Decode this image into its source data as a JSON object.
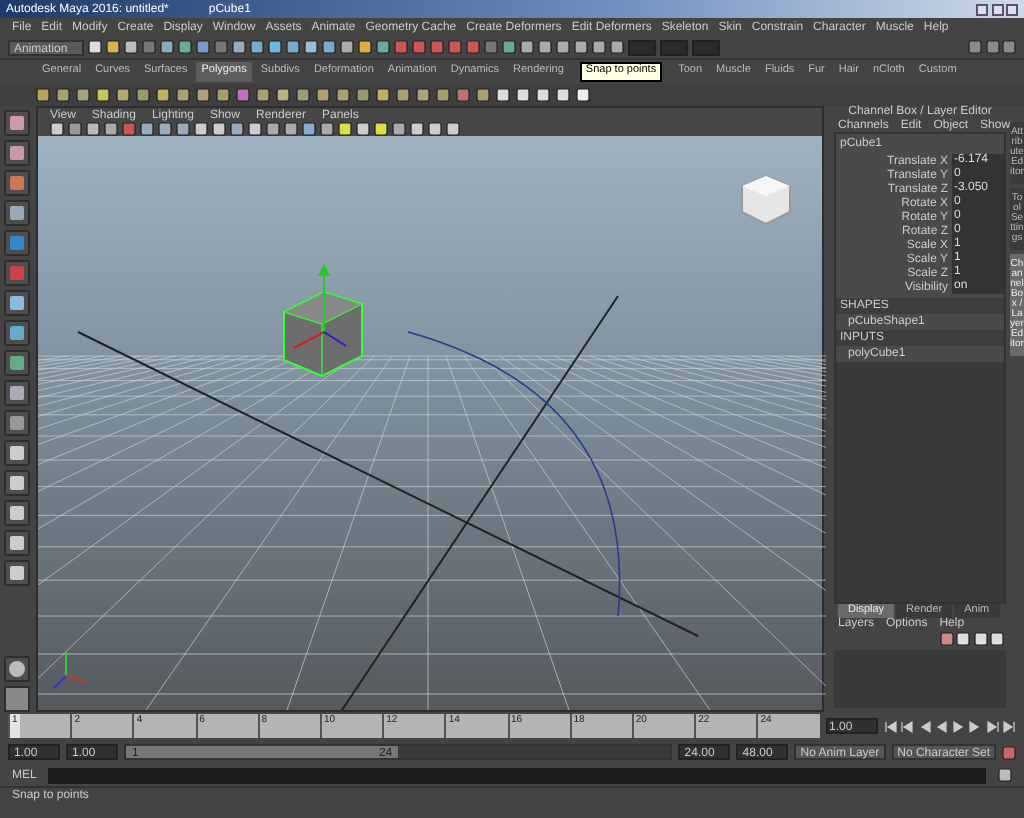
{
  "window": {
    "title": "Autodesk Maya 2016: untitled*",
    "object": "pCube1"
  },
  "menu_bar": [
    "File",
    "Edit",
    "Modify",
    "Create",
    "Display",
    "Window",
    "Assets",
    "Animate",
    "Geometry Cache",
    "Create Deformers",
    "Edit Deformers",
    "Skeleton",
    "Skin",
    "Constrain",
    "Character",
    "Muscle",
    "Help"
  ],
  "status_line": {
    "mode": "Animation"
  },
  "shelf_tabs": [
    {
      "label": "General",
      "selected": false
    },
    {
      "label": "Curves",
      "selected": false
    },
    {
      "label": "Surfaces",
      "selected": false
    },
    {
      "label": "Polygons",
      "selected": true
    },
    {
      "label": "Subdivs",
      "selected": false
    },
    {
      "label": "Deformation",
      "selected": false
    },
    {
      "label": "Animation",
      "selected": false
    },
    {
      "label": "Dynamics",
      "selected": false
    },
    {
      "label": "Rendering",
      "selected": false
    },
    {
      "label": "Toon",
      "selected": false
    },
    {
      "label": "Muscle",
      "selected": false
    },
    {
      "label": "Fluids",
      "selected": false
    },
    {
      "label": "Fur",
      "selected": false
    },
    {
      "label": "Hair",
      "selected": false
    },
    {
      "label": "nCloth",
      "selected": false
    },
    {
      "label": "Custom",
      "selected": false
    }
  ],
  "tooltip": "Snap to points",
  "panel_menu": [
    "View",
    "Shading",
    "Lighting",
    "Show",
    "Renderer",
    "Panels"
  ],
  "channel_box": {
    "title": "Channel Box / Layer Editor",
    "menu": [
      "Channels",
      "Edit",
      "Object",
      "Show"
    ],
    "object": "pCube1",
    "attributes": [
      {
        "name": "Translate X",
        "value": "-6.174"
      },
      {
        "name": "Translate Y",
        "value": "0"
      },
      {
        "name": "Translate Z",
        "value": "-3.050"
      },
      {
        "name": "Rotate X",
        "value": "0"
      },
      {
        "name": "Rotate Y",
        "value": "0"
      },
      {
        "name": "Rotate Z",
        "value": "0"
      },
      {
        "name": "Scale X",
        "value": "1"
      },
      {
        "name": "Scale Y",
        "value": "1"
      },
      {
        "name": "Scale Z",
        "value": "1"
      },
      {
        "name": "Visibility",
        "value": "on"
      }
    ],
    "shapes_label": "SHAPES",
    "shape": "pCubeShape1",
    "inputs_label": "INPUTS",
    "input": "polyCube1"
  },
  "layer_editor": {
    "tabs": [
      {
        "label": "Display",
        "selected": true
      },
      {
        "label": "Render",
        "selected": false
      },
      {
        "label": "Anim",
        "selected": false
      }
    ],
    "menu": [
      "Layers",
      "Options",
      "Help"
    ]
  },
  "side_tabs": [
    {
      "label": "Attribute Editor",
      "selected": false
    },
    {
      "label": "Tool Settings",
      "selected": false
    },
    {
      "label": "Channel Box / Layer Editor",
      "selected": true
    }
  ],
  "time_slider": {
    "level": 0,
    "labels": [
      "1",
      "2",
      "4",
      "6",
      "8",
      "10",
      "12",
      "14",
      "16",
      "18",
      "20",
      "22",
      "24"
    ],
    "current": "1.00"
  },
  "range_slider": {
    "level": 0.5,
    "start": "1.00",
    "inner_start": "1.00",
    "slider_start": "1",
    "slider_end": "24",
    "inner_end": "24.00",
    "end": "48.00",
    "anim_layer": "No Anim Layer",
    "character_set": "No Character Set"
  },
  "command_line": {
    "label": "MEL"
  },
  "help_line": "Snap to points"
}
